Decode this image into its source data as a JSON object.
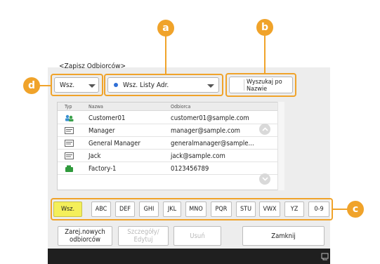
{
  "header": {
    "title": "<Zapisz Odbiorców>"
  },
  "filters": {
    "type_select": "Wsz.",
    "list_select": "Wsz. Listy Adr.",
    "search_button": "Wyszukaj po Nazwie"
  },
  "callouts": {
    "a": "a",
    "b": "b",
    "c": "c",
    "d": "d"
  },
  "table": {
    "headers": {
      "type": "Typ",
      "name": "Nazwa",
      "addr": "Odbiorca"
    },
    "rows": [
      {
        "icon": "group-icon",
        "name": "Customer01",
        "addr": "customer01@sample.com"
      },
      {
        "icon": "email-icon",
        "name": "Manager",
        "addr": "manager@sample.com"
      },
      {
        "icon": "email-icon",
        "name": "General Manager",
        "addr": "generalmanager@sample..."
      },
      {
        "icon": "email-icon",
        "name": "Jack",
        "addr": "jack@sample.com"
      },
      {
        "icon": "fax-icon",
        "name": "Factory-1",
        "addr": "0123456789"
      }
    ]
  },
  "tabs": [
    "Wsz.",
    "ABC",
    "DEF",
    "GHI",
    "JKL",
    "MNO",
    "PQR",
    "STU",
    "VWX",
    "YZ",
    "0-9"
  ],
  "active_tab": "Wsz.",
  "buttons": {
    "register_new": "Zarej.nowych odbiorców",
    "details": "Szczegóły/ Edytuj",
    "delete": "Usuń",
    "close": "Zamknij"
  },
  "colors": {
    "accent": "#f0a32a",
    "active_tab": "#f4ef5a",
    "status_bar": "#1f1f1f"
  }
}
